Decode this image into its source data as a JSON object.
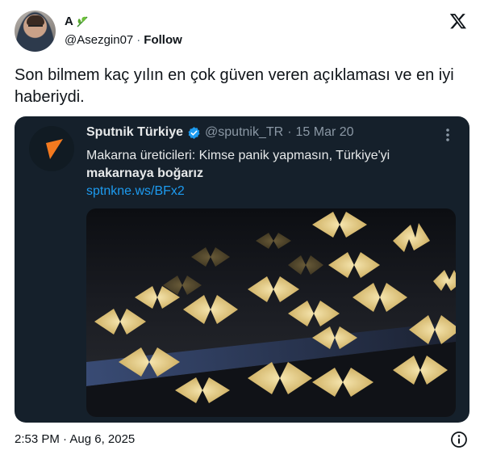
{
  "author": {
    "display_name": "A",
    "name_emoji_icon": "leaf-icon",
    "handle": "@Asezgin07",
    "separator": "·",
    "follow_label": "Follow"
  },
  "tweet": {
    "text": "Son bilmem kaç yılın en çok güven veren açıklaması ve en iyi haberiydi."
  },
  "quoted": {
    "name": "Sputnik Türkiye",
    "handle": "@sputnik_TR",
    "sep": "·",
    "date": "15 Mar 20",
    "text_plain": "Makarna üreticileri: Kimse panik yapmasın, Türkiye'yi",
    "text_bold": "makarnaya boğarız",
    "link": "sptnkne.ws/BFx2",
    "accent": "#f47a1f",
    "link_color": "#1d9bf0"
  },
  "footer": {
    "time": "2:53 PM · Aug 6, 2025"
  }
}
